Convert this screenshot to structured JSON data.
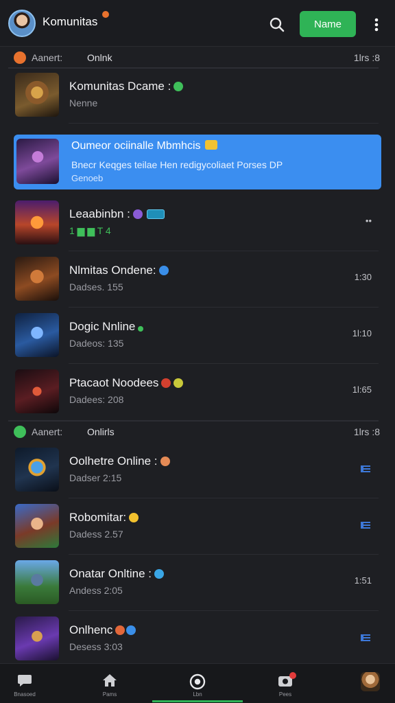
{
  "header": {
    "app_title": "Komunitas",
    "primary_button": "Name",
    "accent": "#2fb356"
  },
  "sections": [
    {
      "left": "Aanert:",
      "mid": "Onlnk",
      "right": "1lrs :8",
      "dot_color": "#e8722e",
      "rows": [
        {
          "title": "Komunitas Dcame :",
          "sub": "Nenne",
          "right": "",
          "emoji": [
            "#3fbf5a"
          ]
        },
        {
          "title": "Oumeor ociinalle Mbmhcis",
          "sub": "Bnecr Keqges teilae Hen redigycoliaet Porses DP",
          "sub2": "Genoeb",
          "highlight": true
        },
        {
          "title": "Leaabinbn :",
          "sub": "1 ▆ ▆ T 4",
          "right": "••",
          "emoji": [
            "#8a5bd6"
          ],
          "pill": true
        },
        {
          "title": "Nlmitas Ondene:",
          "sub": "Dadses. 155",
          "right": "1:30",
          "emoji": [
            "#3a8ee8"
          ]
        },
        {
          "title": "Dogic Nnline",
          "sub": "Dadeos: 135",
          "right": "1l:10",
          "emoji": [
            "#3fbf5a"
          ]
        },
        {
          "title": "Ptacaot Noodees",
          "sub": "Dadees: 208",
          "right": "1l:65",
          "emoji": [
            "#d3402f",
            "#c9c93a"
          ]
        }
      ]
    },
    {
      "left": "Aanert:",
      "mid": "Onlirls",
      "right": "1lrs :8",
      "dot_color": "#3fbf5a",
      "rows": [
        {
          "title": "Oolhetre Online :",
          "sub": "Dadser 2:15",
          "list_icon": true,
          "emoji": [
            "#e58b56"
          ]
        },
        {
          "title": "Robomitar:",
          "sub": "Dadess 2.57",
          "list_icon": true,
          "emoji": [
            "#f2c12e"
          ]
        },
        {
          "title": "Onatar Onltine :",
          "sub": "Andess 2:05",
          "right": "1:51",
          "emoji": [
            "#3aa6e6"
          ]
        },
        {
          "title": "Onlhenc",
          "sub": "Desess 3:03",
          "list_icon": true,
          "emoji": [
            "#e2673a",
            "#3a8ee8"
          ]
        }
      ]
    }
  ],
  "bottom_nav": [
    {
      "label": "Bnasoed",
      "icon": "chat-bubble-icon"
    },
    {
      "label": "Pams",
      "icon": "home-icon"
    },
    {
      "label": "Lbn",
      "icon": "record-circle-icon"
    },
    {
      "label": "Pees",
      "icon": "camera-icon"
    },
    {
      "label": "",
      "icon": "profile-avatar-icon"
    }
  ]
}
